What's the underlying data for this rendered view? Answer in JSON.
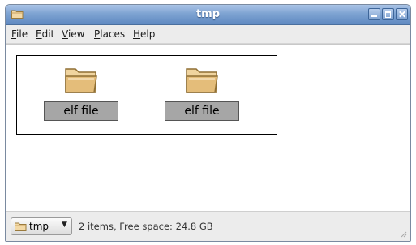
{
  "window": {
    "title": "tmp"
  },
  "menubar": {
    "items": [
      {
        "mnemonic": "F",
        "rest": "ile"
      },
      {
        "mnemonic": "E",
        "rest": "dit"
      },
      {
        "mnemonic": "V",
        "rest": "iew"
      },
      {
        "mnemonic": "P",
        "rest": "laces"
      },
      {
        "mnemonic": "H",
        "rest": "elp"
      }
    ]
  },
  "files": [
    {
      "name": "elf file",
      "icon": "folder-icon"
    },
    {
      "name": "elf file",
      "icon": "folder-icon"
    }
  ],
  "statusbar": {
    "location": "tmp",
    "status": "2 items, Free space: 24.8 GB"
  },
  "colors": {
    "titlebar": "#7ea3d2",
    "folder": "#e8c68a",
    "label_bg": "#a6a6a6"
  }
}
